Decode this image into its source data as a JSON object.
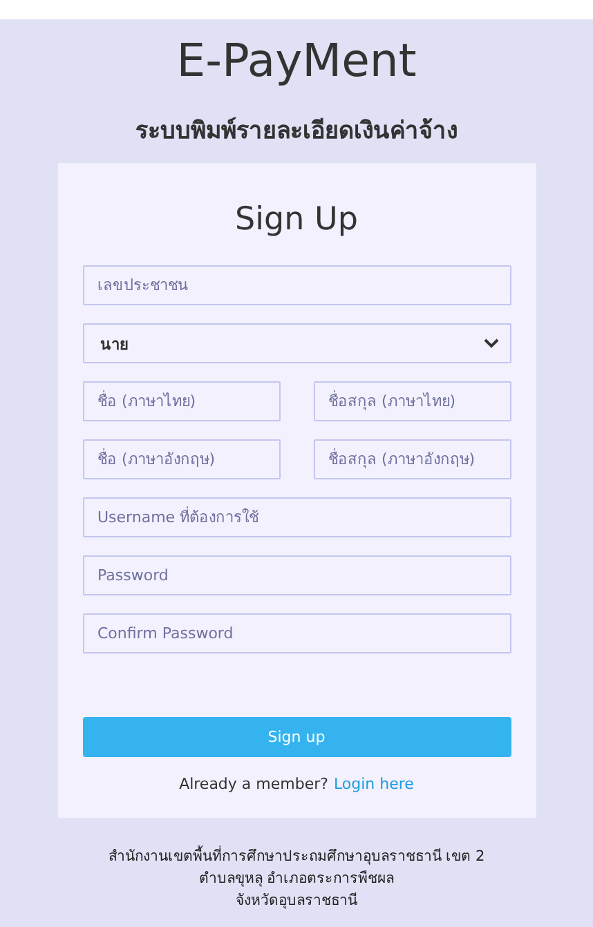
{
  "app_title": "E-PayMent",
  "subtitle": "ระบบพิมพ์รายละเอียดเงินค่าจ้าง",
  "form": {
    "title": "Sign Up",
    "rows": [
      [
        {
          "kind": "input",
          "placeholder": "เลขประชาชน"
        }
      ],
      [
        {
          "kind": "select",
          "value": "นาย"
        }
      ],
      [
        {
          "kind": "input",
          "placeholder": "ชื่อ (ภาษาไทย)"
        },
        {
          "kind": "input",
          "placeholder": "ชื่อสกุล (ภาษาไทย)"
        }
      ],
      [
        {
          "kind": "input",
          "placeholder": "ชื่อ (ภาษาอังกฤษ)"
        },
        {
          "kind": "input",
          "placeholder": "ชื่อสกุล (ภาษาอังกฤษ)"
        }
      ],
      [
        {
          "kind": "input",
          "placeholder": "Username ที่ต้องการใช้"
        }
      ],
      [
        {
          "kind": "password",
          "placeholder": "Password"
        }
      ],
      [
        {
          "kind": "password",
          "placeholder": "Confirm Password"
        }
      ]
    ],
    "submit": "Sign up",
    "member_prompt": "Already a member?",
    "login_link": "Login here"
  },
  "footer": [
    "สำนักงานเขตพื้นที่การศึกษาประถมศึกษาอุบลราชธานี เขต 2",
    "ตำบลขุหลุ อำเภอตระการพืชผล",
    "จังหวัดอุบลราชธานี"
  ]
}
